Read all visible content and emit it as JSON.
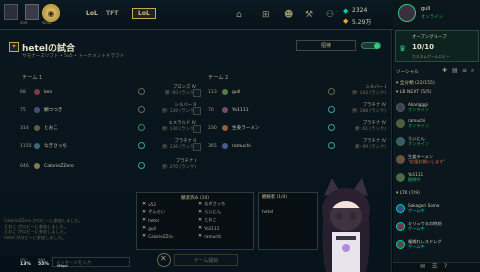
{
  "header": {
    "tabs": [
      {
        "label": "LoL"
      },
      {
        "label": "TFT"
      },
      {
        "label": "LoL"
      }
    ],
    "tool_labels": [
      "ZOR",
      "SEGA"
    ],
    "currency": {
      "blue": "2324",
      "orange": "5.29万"
    }
  },
  "lobby": {
    "title": "hetelの試合",
    "subtitle": "サモナーズリフト • 5v5 • トーナメントドラフト",
    "invite_button": "招待",
    "team1_label": "チーム 1",
    "team2_label": "チーム 2",
    "team1": [
      {
        "level": "68",
        "name": "ken",
        "rank": "ブロンズ IV",
        "lp": "勝: 60 (ランク)"
      },
      {
        "level": "75",
        "name": "鯛つつき",
        "rank": "シルバー II",
        "lp": "勝: 139 (ランク)"
      },
      {
        "level": "314",
        "name": "とおこ",
        "rank": "エメラルド IV",
        "lp": "勝: 130 (ランク)"
      },
      {
        "level": "1155",
        "name": "なぎさっち",
        "rank": "プラチナ II",
        "lp": "勝: 236 (ランク)"
      },
      {
        "level": "646",
        "name": "CalorieZZero",
        "rank": "プラチナ I",
        "lp": "勝: 270 (ランク)"
      }
    ],
    "team2": [
      {
        "level": "113",
        "name": "gull",
        "rank": "シルバー I",
        "lp": "勝: 143 (ランク)"
      },
      {
        "level": "70",
        "name": "Yo1111",
        "rank": "プラチナ IV",
        "lp": "勝: 188 (ランク)"
      },
      {
        "level": "230",
        "name": "生姜ラーメン",
        "rank": "プラチナ IV",
        "lp": "勝: 61 (ランク)"
      },
      {
        "level": "365",
        "name": "ramuchi",
        "rank": "プラチナ IV",
        "lp": "勝: 99 (ランク)"
      }
    ],
    "bans": {
      "header": "撤退済み (10)",
      "left": [
        "v52",
        "ぞんせい",
        "hetel",
        "gull",
        "CalorieZZro"
      ],
      "right": [
        "なぎさっち",
        "らいにん",
        "とおこ",
        "Yo1111",
        "ramuchi"
      ]
    },
    "spectators": {
      "header": "観戦者 (1/4)",
      "names": [
        "hetel"
      ]
    },
    "start_button": "ゲーム開始",
    "chat_lines": [
      "CalorieZZero がロビーに参加しました。",
      "とおこ がロビーに参加しました。",
      "とおこ がロビーに参加しました。",
      "hetel がロビーに参加しました。"
    ],
    "chat_placeholder": "メッセージを入力"
  },
  "perf": {
    "fps": "13%",
    "fps_label": "CPU",
    "ram": "55%",
    "ram_label": "RAM",
    "net": "Mbps"
  },
  "social": {
    "user_name": "gull",
    "user_status": "オンライン",
    "party_label": "オープングループ",
    "party_count": "10/10",
    "party_sub": "カスタムゲームロビー",
    "social_label": "ソーシャル",
    "group_all": "▾ 全分類 (22/155)",
    "group_lb": "▾ LB NEXT (5/5)",
    "group_ltk": "▾ LTK (7/9)",
    "friends_a": [
      {
        "name": "Akarigggi",
        "status": "オンライン",
        "type": "online"
      },
      {
        "name": "ramuchi",
        "status": "オンライン",
        "type": "online"
      },
      {
        "name": "らいにん",
        "status": "オンライン",
        "type": "online"
      },
      {
        "name": "生姜ラーメン",
        "status": "\"応援お願いします\"",
        "type": "away"
      },
      {
        "name": "Yo1111",
        "status": "観戦中",
        "type": "online"
      }
    ],
    "friends_b": [
      {
        "name": "Sakagori Soma",
        "status": "ゲーム中",
        "type": "ingame"
      },
      {
        "name": "キリュウるの時刻",
        "status": "ゲーム中",
        "type": "ingame"
      },
      {
        "name": "複雑れレスドレグ",
        "status": "ゲーム中",
        "type": "ingame"
      }
    ]
  }
}
